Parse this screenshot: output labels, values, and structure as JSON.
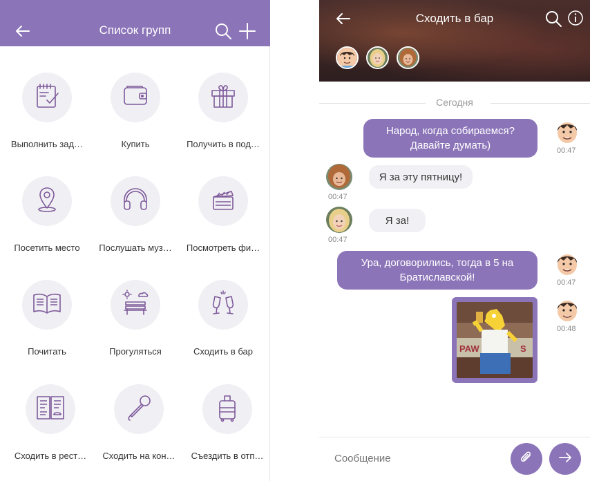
{
  "left_screen": {
    "title": "Список групп",
    "icons": {
      "back": "back-arrow-icon",
      "search": "search-icon",
      "add": "plus-icon"
    },
    "items": [
      {
        "label": "Выполнить зад…",
        "icon": "task-checklist-icon"
      },
      {
        "label": "Купить",
        "icon": "wallet-icon"
      },
      {
        "label": "Получить в под…",
        "icon": "gift-icon"
      },
      {
        "label": "Посетить место",
        "icon": "map-pin-icon"
      },
      {
        "label": "Послушать муз…",
        "icon": "headphones-icon"
      },
      {
        "label": "Посмотреть фи…",
        "icon": "clapperboard-icon"
      },
      {
        "label": "Почитать",
        "icon": "open-book-icon"
      },
      {
        "label": "Прогуляться",
        "icon": "park-bench-icon"
      },
      {
        "label": "Сходить в бар",
        "icon": "champagne-glasses-icon"
      },
      {
        "label": "Сходить в рест…",
        "icon": "restaurant-menu-icon"
      },
      {
        "label": "Сходить на кон…",
        "icon": "microphone-icon"
      },
      {
        "label": "Съездить в отп…",
        "icon": "suitcase-icon"
      }
    ]
  },
  "right_screen": {
    "chat_title": "Сходить в бар",
    "date_separator": "Сегодня",
    "messages": [
      {
        "direction": "out",
        "text": "Народ, когда собираемся? Давайте думать)",
        "time": "00:47",
        "avatar": "cartoon-man-avatar"
      },
      {
        "direction": "in",
        "text": "Я за эту пятницу!",
        "time": "00:47",
        "avatar": "curly-hair-person-avatar"
      },
      {
        "direction": "in",
        "text": "Я за!",
        "time": "00:47",
        "avatar": "blonde-woman-avatar"
      },
      {
        "direction": "out",
        "text": "Ура, договорились, тогда в 5 на Братиславской!",
        "time": "00:47",
        "avatar": "cartoon-man-avatar"
      },
      {
        "direction": "out",
        "image": "homer-simpson-beer-gif",
        "time": "00:48",
        "avatar": "cartoon-man-avatar"
      }
    ],
    "composer": {
      "placeholder": "Сообщение"
    },
    "colors": {
      "accent": "#8b74b8",
      "bubble_in": "#f1f0f4"
    }
  }
}
